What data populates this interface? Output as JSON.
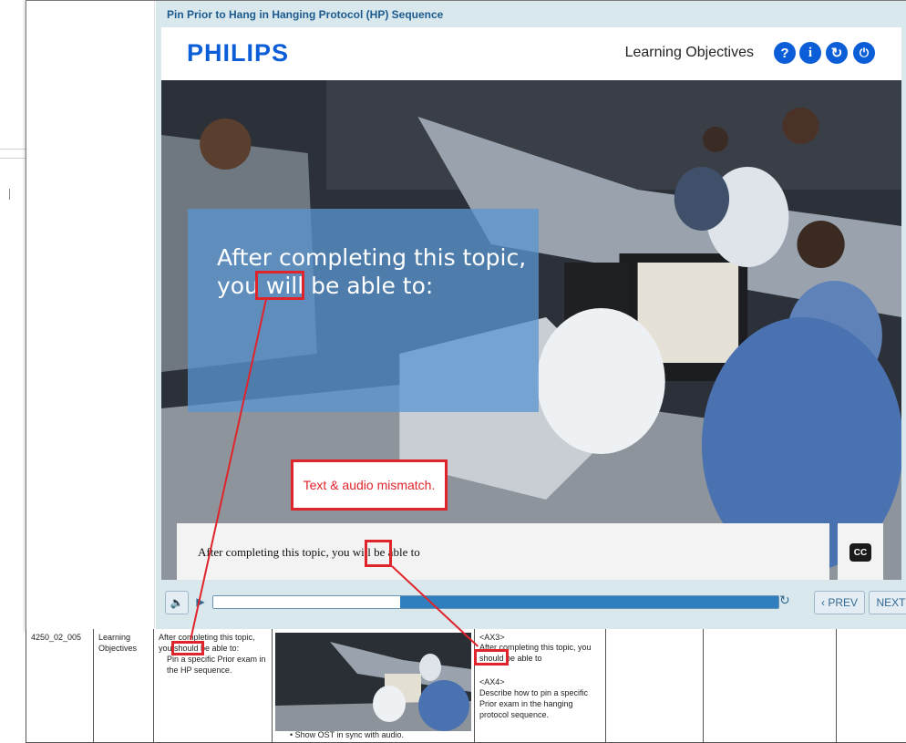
{
  "player": {
    "title": "Pin Prior to Hang in Hanging Protocol (HP) Sequence",
    "logo": "PHILIPS",
    "section_title": "Learning Objectives",
    "header_buttons": [
      {
        "icon": "help-icon",
        "glyph": "?"
      },
      {
        "icon": "info-icon",
        "glyph": "i"
      },
      {
        "icon": "replay-icon",
        "glyph": "↻"
      },
      {
        "icon": "power-icon",
        "glyph": "⏻"
      }
    ],
    "overlay_text": "After completing this topic, you will be able to:",
    "caption": "After completing this topic, you will be able to",
    "cc_label": "CC",
    "callout": "Text & audio mismatch.",
    "prev_label": "‹ PREV",
    "next_label": "NEXT ›",
    "progress": 0.33
  },
  "table": {
    "id": "4250_02_005",
    "screen_name": "Learning Objectives",
    "onscreen_text_line1": "After completing this topic,",
    "onscreen_text_line2": "you should be able to:",
    "onscreen_text_bullet": "Pin a specific Prior exam in the HP sequence.",
    "graphic_note": "Show OST in sync with audio.",
    "audio_tag1": "<AX3>",
    "audio_text1": "After completing this topic, you should be able to",
    "audio_tag2": "<AX4>",
    "audio_text2": "Describe how to pin a specific Prior exam in the hanging protocol sequence."
  },
  "colors": {
    "brand_blue": "#0b5ed7",
    "annotation_red": "#e0242b",
    "title_blue": "#1c5a8f"
  }
}
